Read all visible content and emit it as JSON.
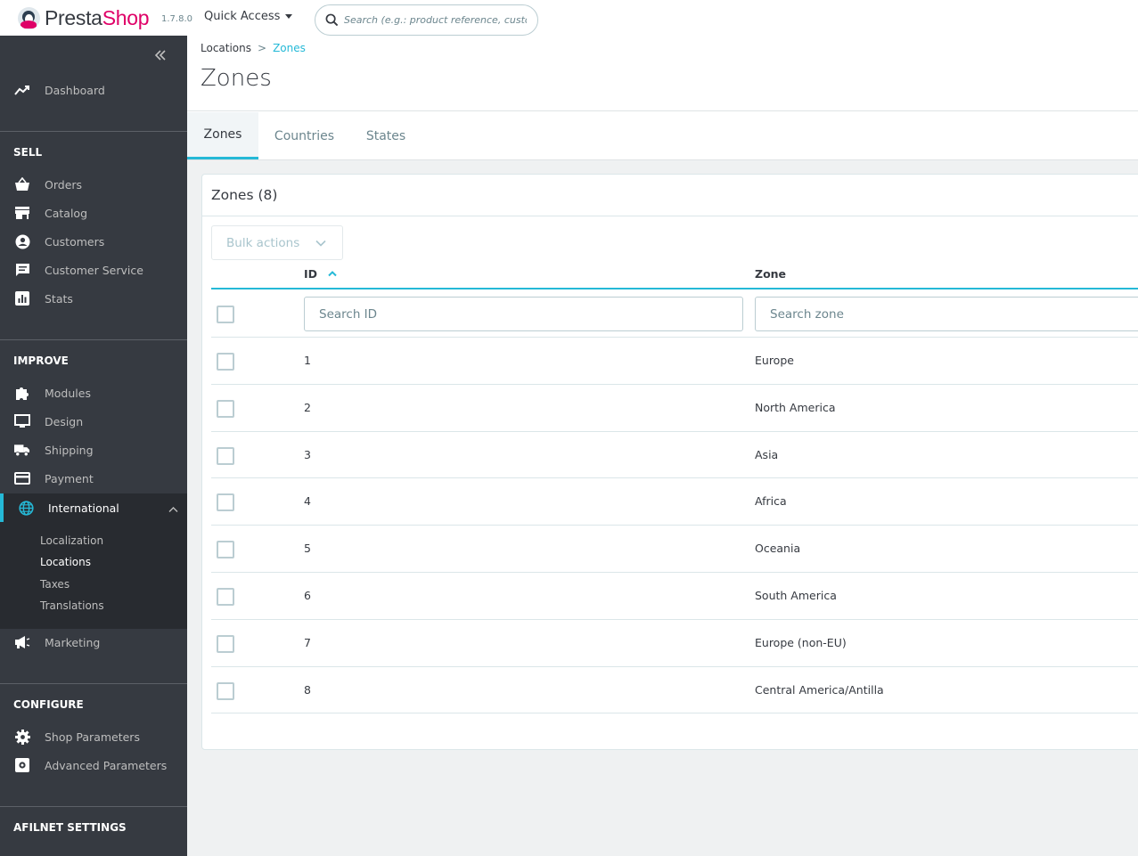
{
  "header": {
    "brand_left": "Presta",
    "brand_right": "Shop",
    "version": "1.7.8.0",
    "quick_access": "Quick Access",
    "search_placeholder": "Search (e.g.: product reference, custon"
  },
  "sidebar": {
    "dashboard": "Dashboard",
    "sections": {
      "sell": "SELL",
      "improve": "IMPROVE",
      "configure": "CONFIGURE",
      "afilnet": "AFILNET SETTINGS"
    },
    "sell_items": [
      "Orders",
      "Catalog",
      "Customers",
      "Customer Service",
      "Stats"
    ],
    "improve_items": [
      "Modules",
      "Design",
      "Shipping",
      "Payment"
    ],
    "international": {
      "label": "International",
      "children": [
        "Localization",
        "Locations",
        "Taxes",
        "Translations"
      ]
    },
    "marketing": "Marketing",
    "configure_items": [
      "Shop Parameters",
      "Advanced Parameters"
    ]
  },
  "breadcrumb": {
    "parent": "Locations",
    "separator": ">",
    "current": "Zones"
  },
  "page_title": "Zones",
  "tabs": [
    "Zones",
    "Countries",
    "States"
  ],
  "card": {
    "title": "Zones (8)",
    "bulk_actions": "Bulk actions",
    "columns": {
      "id": "ID",
      "zone": "Zone"
    },
    "filters": {
      "id_placeholder": "Search ID",
      "zone_placeholder": "Search zone"
    },
    "rows": [
      {
        "id": "1",
        "zone": "Europe"
      },
      {
        "id": "2",
        "zone": "North America"
      },
      {
        "id": "3",
        "zone": "Asia"
      },
      {
        "id": "4",
        "zone": "Africa"
      },
      {
        "id": "5",
        "zone": "Oceania"
      },
      {
        "id": "6",
        "zone": "South America"
      },
      {
        "id": "7",
        "zone": "Europe (non-EU)"
      },
      {
        "id": "8",
        "zone": "Central America/Antilla"
      }
    ]
  },
  "colors": {
    "accent": "#25b9d7",
    "sidebar_bg": "#363a41",
    "sidebar_active_bg": "#282b30",
    "brand_pink": "#df0067"
  }
}
